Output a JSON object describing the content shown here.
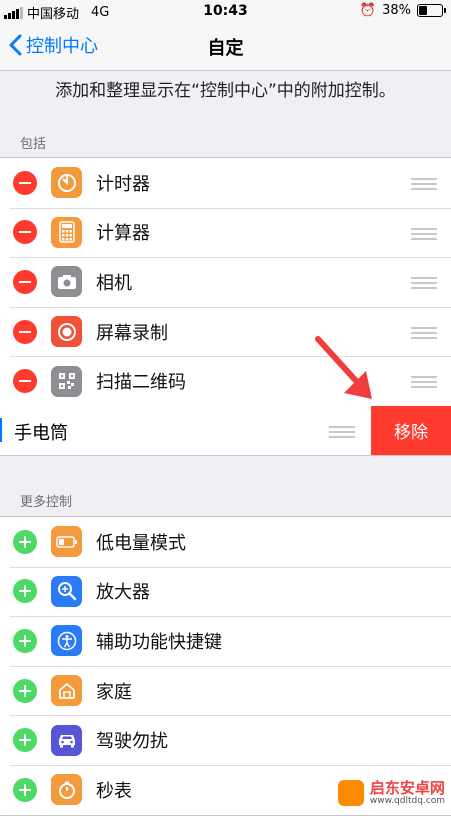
{
  "status_bar": {
    "carrier": "中国移动",
    "network": "4G",
    "time": "10:43",
    "battery_percent": "38%"
  },
  "nav": {
    "back_label": "控制中心",
    "title": "自定"
  },
  "description": "添加和整理显示在“控制中心”中的附加控制。",
  "included": {
    "header": "包括",
    "items": [
      {
        "label": "计时器",
        "icon": "timer-icon",
        "color": "#f39a3c"
      },
      {
        "label": "计算器",
        "icon": "calculator-icon",
        "color": "#f39a3c"
      },
      {
        "label": "相机",
        "icon": "camera-icon",
        "color": "#8e8e93"
      },
      {
        "label": "屏幕录制",
        "icon": "screen-record-icon",
        "color": "#f05138"
      },
      {
        "label": "扫描二维码",
        "icon": "qr-code-icon",
        "color": "#8e8e93"
      }
    ],
    "swiped_item": {
      "label": "手电筒",
      "action": "移除"
    }
  },
  "more": {
    "header": "更多控制",
    "items": [
      {
        "label": "低电量模式",
        "icon": "low-power-icon",
        "color": "#f39a3c"
      },
      {
        "label": "放大器",
        "icon": "magnifier-icon",
        "color": "#2b7bf6"
      },
      {
        "label": "辅助功能快捷键",
        "icon": "accessibility-icon",
        "color": "#2b7bf6"
      },
      {
        "label": "家庭",
        "icon": "home-icon",
        "color": "#f39a3c"
      },
      {
        "label": "驾驶勿扰",
        "icon": "car-icon",
        "color": "#5856d6"
      },
      {
        "label": "秒表",
        "icon": "stopwatch-icon",
        "color": "#f39a3c"
      }
    ]
  },
  "watermark": {
    "name": "启东安卓网",
    "url": "www.qdltdq.com"
  },
  "colors": {
    "accent": "#007aff",
    "remove": "#ff3b30",
    "add": "#4cd964"
  }
}
